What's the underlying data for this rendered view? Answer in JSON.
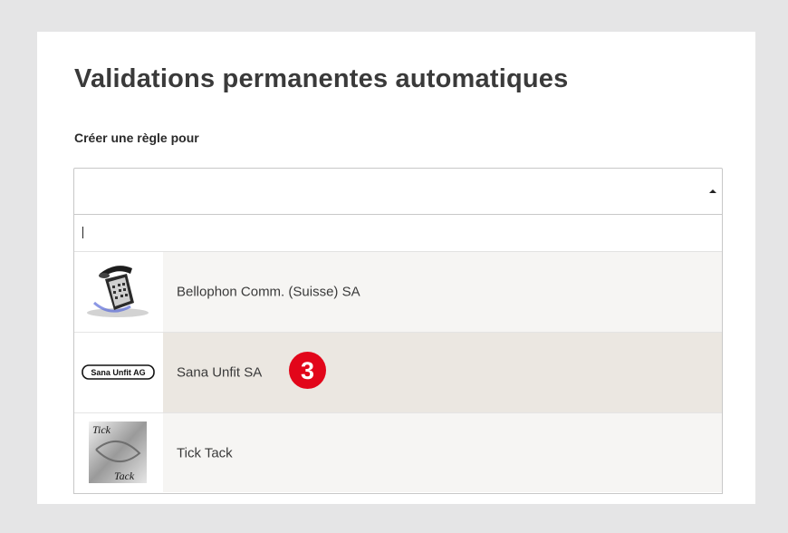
{
  "page": {
    "title": "Validations permanentes automatiques",
    "rule_label": "Créer une règle pour"
  },
  "select": {
    "value": "",
    "caret_icon": "caret-up-icon"
  },
  "search": {
    "value": "",
    "placeholder": ""
  },
  "options": [
    {
      "label": "Bellophon Comm. (Suisse) SA",
      "logo": "telephone-logo",
      "highlighted": false
    },
    {
      "label": "Sana Unfit SA",
      "logo": "sana-unfit-logo",
      "logo_text": "Sana Unfit AG",
      "highlighted": true
    },
    {
      "label": "Tick Tack",
      "logo": "tick-tack-logo",
      "logo_text": "Tick Tack",
      "highlighted": false
    }
  ],
  "annotation": {
    "step": "3",
    "color": "#e2061a"
  },
  "colors": {
    "background": "#e5e5e6",
    "option_bg": "#f6f5f3",
    "option_highlight": "#ebe7e1"
  }
}
